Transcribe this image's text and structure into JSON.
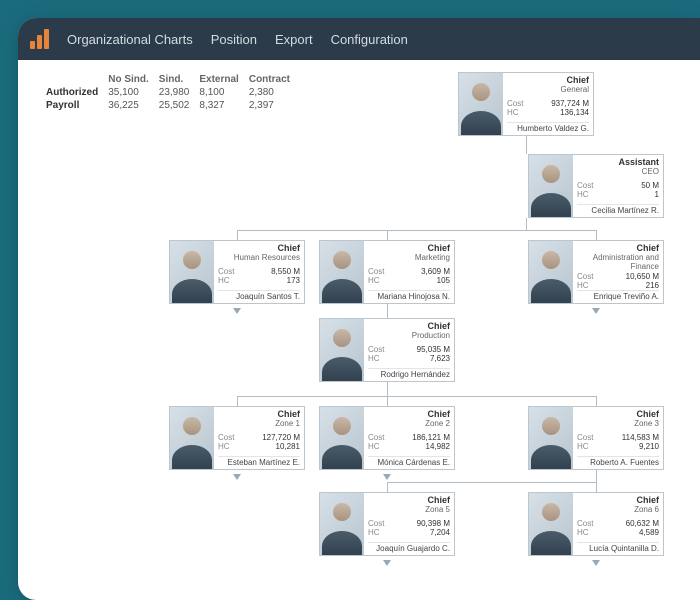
{
  "nav": {
    "items": [
      "Organizational Charts",
      "Position",
      "Export",
      "Configuration"
    ]
  },
  "summary": {
    "headers": [
      "No Sind.",
      "Sind.",
      "External",
      "Contract"
    ],
    "rows": [
      {
        "label": "Authorized",
        "values": [
          "35,100",
          "23,980",
          "8,100",
          "2,380"
        ]
      },
      {
        "label": "Payroll",
        "values": [
          "36,225",
          "25,502",
          "8,327",
          "2,397"
        ]
      }
    ]
  },
  "metric_labels": {
    "cost": "Cost",
    "hc": "HC"
  },
  "nodes": {
    "general": {
      "role": "Chief",
      "dept": "General",
      "cost": "937,724 M",
      "hc": "136,134",
      "name": "Humberto Valdez G."
    },
    "assistant": {
      "role": "Assistant",
      "dept": "CEO",
      "cost": "50 M",
      "hc": "1",
      "name": "Cecilia Martínez R."
    },
    "hr": {
      "role": "Chief",
      "dept": "Human Resources",
      "cost": "8,550 M",
      "hc": "173",
      "name": "Joaquín Santos T."
    },
    "marketing": {
      "role": "Chief",
      "dept": "Marketing",
      "cost": "3,609 M",
      "hc": "105",
      "name": "Mariana Hinojosa N."
    },
    "adminfin": {
      "role": "Chief",
      "dept": "Administration and Finance",
      "cost": "10,650 M",
      "hc": "216",
      "name": "Enrique Treviño A."
    },
    "prod": {
      "role": "Chief",
      "dept": "Production",
      "cost": "95,035 M",
      "hc": "7,623",
      "name": "Rodrigo Hernández"
    },
    "zone1": {
      "role": "Chief",
      "dept": "Zone 1",
      "cost": "127,720 M",
      "hc": "10,281",
      "name": "Esteban Martínez E."
    },
    "zone2": {
      "role": "Chief",
      "dept": "Zone 2",
      "cost": "186,121 M",
      "hc": "14,982",
      "name": "Mónica Cárdenas E."
    },
    "zone3": {
      "role": "Chief",
      "dept": "Zone 3",
      "cost": "114,583 M",
      "hc": "9,210",
      "name": "Roberto A. Fuentes"
    },
    "zona5": {
      "role": "Chief",
      "dept": "Zona 5",
      "cost": "90,398 M",
      "hc": "7,204",
      "name": "Joaquín Guajardo C."
    },
    "zona6": {
      "role": "Chief",
      "dept": "Zona 6",
      "cost": "60,632 M",
      "hc": "4,589",
      "name": "Lucía Quintanilla D."
    }
  }
}
